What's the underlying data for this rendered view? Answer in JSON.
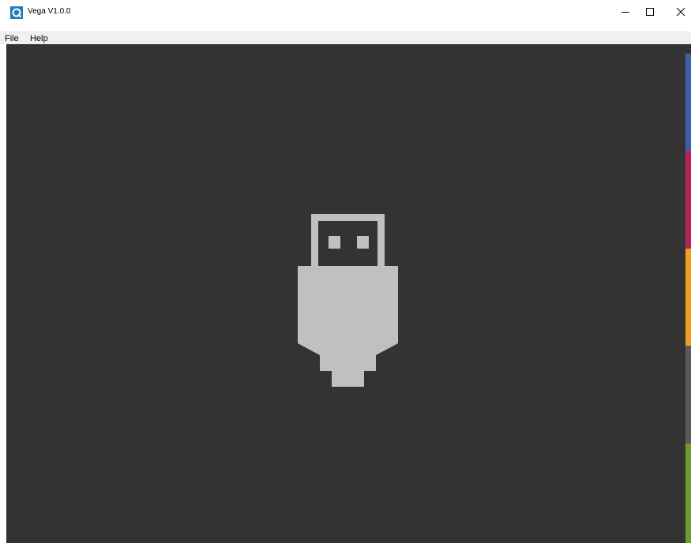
{
  "window": {
    "title": "Vega V1.0.0",
    "icon": "app-logo-icon"
  },
  "caption_buttons": {
    "minimize": "minimize-icon",
    "maximize": "maximize-icon",
    "close": "close-icon"
  },
  "menu": {
    "items": [
      {
        "label": "File"
      },
      {
        "label": "Help"
      }
    ]
  },
  "content": {
    "state_icon": "usb-plug-icon",
    "background_color": "#333333",
    "icon_color": "#c0c0c0"
  },
  "side_strip": {
    "colors": [
      "#3f5fa8",
      "#b3245e",
      "#f0a020",
      "#5a5a5a",
      "#6e9a2e"
    ]
  }
}
